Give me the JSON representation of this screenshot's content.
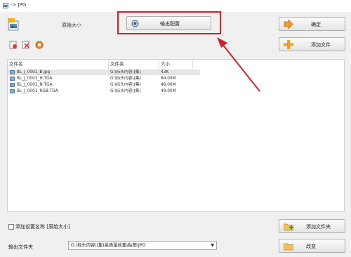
{
  "window": {
    "title": "-> JPG"
  },
  "top": {
    "original_size_label": "原始大小",
    "output_config_label": "输出配置",
    "ok_label": "确定",
    "add_file_label": "添加文件"
  },
  "list": {
    "columns": [
      "文件名",
      "文件夹",
      "大小"
    ],
    "rows": [
      {
        "name": "BL_J_0001_B.jpg",
        "folder": "G:\\标头内容\\(集)",
        "size": "43K"
      },
      {
        "name": "BL_J_0001_H.TGA",
        "folder": "G:\\标头内容\\(集)",
        "size": "64.00M"
      },
      {
        "name": "BL_J_0001_N.TGA",
        "folder": "G:\\标头内容\\(集)",
        "size": "48.00M"
      },
      {
        "name": "BL_J_0001_RGB.TGA",
        "folder": "G:\\标头内容\\(集)",
        "size": "48.00M"
      }
    ]
  },
  "bottom": {
    "add_setting_name": "添加设置名称 [原始大小]",
    "add_folder_label": "添加文件夹",
    "change_label": "改变",
    "output_folder_label": "输出文件夹",
    "output_folder_value": "G:\\标头内容\\(集)高质量收集\\贴图\\JPG"
  },
  "colors": {
    "highlight": "#d3202a",
    "arrow": "#d3202a"
  },
  "icons": [
    "app-icon",
    "jpg-format-icon",
    "output-config-icon",
    "ok-arrow-icon",
    "add-plus-icon",
    "remove-icon",
    "clear-icon",
    "stop-icon",
    "folder-icon"
  ]
}
